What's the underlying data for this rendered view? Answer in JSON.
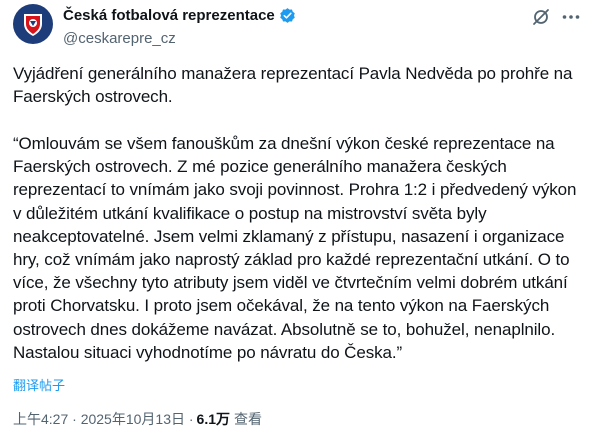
{
  "author": {
    "display_name": "Česká fotbalová reprezentace",
    "handle": "@ceskarepre_cz",
    "verified": true
  },
  "icons": {
    "avatar": "czech-football-crest-icon",
    "verified": "verified-badge-icon",
    "grok": "grok-icon",
    "more": "more-dots-icon"
  },
  "colors": {
    "accent": "#1d9bf0",
    "secondary_text": "#536471",
    "primary_text": "#0f1419",
    "crest_blue": "#1d3c7a",
    "crest_red": "#d7141a"
  },
  "tweet": {
    "paragraph_1": "Vyjádření generálního manažera reprezentací Pavla Nedvěda po prohře na Faerských ostrovech.",
    "paragraph_2": "“Omlouvám se všem fanouškům za dnešní výkon české reprezentace na Faerských ostrovech. Z mé pozice generálního manažera českých reprezentací to vnímám jako svoji povinnost. Prohra 1:2 i předvedený výkon v důležitém utkání kvalifikace o postup na mistrovství světa byly neakceptovatelné. Jsem velmi zklamaný z přístupu, nasazení i organizace hry, což vnímám jako naprostý základ pro každé reprezentační utkání. O to více, že všechny tyto atributy jsem viděl ve čtvrtečním velmi dobrém utkání proti Chorvatsku. I proto jsem očekával, že na tento výkon na Faerských ostrovech dnes dokážeme navázat. Absolutně se to, bohužel, nenaplnilo. Nastalou situaci vyhodnotíme po návratu do Česka.”",
    "translate_label": "翻译帖子"
  },
  "meta": {
    "timestamp": "上午4:27 · 2025年10月13日 ·",
    "views_count": "6.1万",
    "views_label": "查看"
  }
}
